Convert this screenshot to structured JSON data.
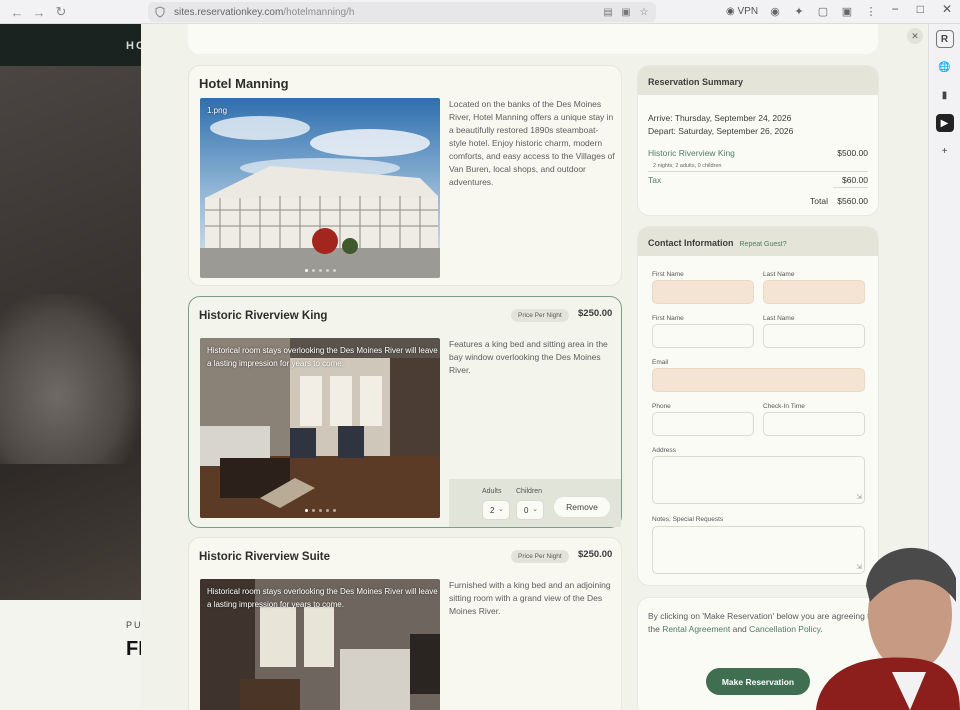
{
  "browser": {
    "url_domain": "sites.reservationkey.com",
    "url_path": "/hotelmanning/h",
    "vpn_label": "VPN",
    "rail_icon_letter": "R"
  },
  "background_site": {
    "nav_text": "HO",
    "lower_kicker": "PU",
    "lower_heading": "FI"
  },
  "hotel": {
    "name": "Hotel Manning",
    "photo_filename": "1.png",
    "description": "Located on the banks of the Des Moines River, Hotel Manning offers a unique stay in a beautifully restored 1890s steamboat-style hotel. Enjoy historic charm, modern comforts, and easy access to the Villages of Van Buren, local shops, and outdoor adventures."
  },
  "rooms": [
    {
      "name": "Historic Riverview King",
      "price_badge": "Price Per Night",
      "price": "$250.00",
      "photo_caption": "Historical room stays overlooking the Des Moines River will leave a lasting impression for years to come.",
      "description": "Features a king bed and sitting area in the bay window overlooking the Des Moines River.",
      "adults_label": "Adults",
      "children_label": "Children",
      "adults_value": "2",
      "children_value": "0",
      "remove_label": "Remove"
    },
    {
      "name": "Historic Riverview Suite",
      "price_badge": "Price Per Night",
      "price": "$250.00",
      "photo_caption": "Historical room stays overlooking the Des Moines River will leave a lasting impression for years to come.",
      "description": "Furnished with a king bed and an adjoining sitting room with a grand view of the Des Moines River."
    }
  ],
  "summary": {
    "title": "Reservation Summary",
    "arrive": "Arrive: Thursday, September 24, 2026",
    "depart": "Depart: Saturday, September 26, 2026",
    "room_name": "Historic Riverview King",
    "room_amount": "$500.00",
    "room_detail": "2 nights; 2 adults, 0 children",
    "tax_label": "Tax",
    "tax_amount": "$60.00",
    "total_label": "Total",
    "total_amount": "$560.00"
  },
  "contact": {
    "title": "Contact Information",
    "repeat_link": "Repeat Guest?",
    "first_name_label": "First Name",
    "last_name_label": "Last Name",
    "first_name_label_2": "First Name",
    "last_name_label_2": "Last Name",
    "email_label": "Email",
    "phone_label": "Phone",
    "checkin_label": "Check-In Time",
    "address_label": "Address",
    "notes_label": "Notes, Special Requests"
  },
  "terms": {
    "text_before": "By clicking on 'Make Reservation' below you are agreeing to the ",
    "rental_link": "Rental Agreement",
    "text_and": " and ",
    "cancel_link": "Cancellation Policy",
    "text_end": "."
  },
  "make_reservation_label": "Make Reservation",
  "colors": {
    "accent_green": "#3f6e51",
    "link_green": "#4f7c62",
    "autofill": "#f3e4d3",
    "modal_bg": "#f1f2ea"
  }
}
